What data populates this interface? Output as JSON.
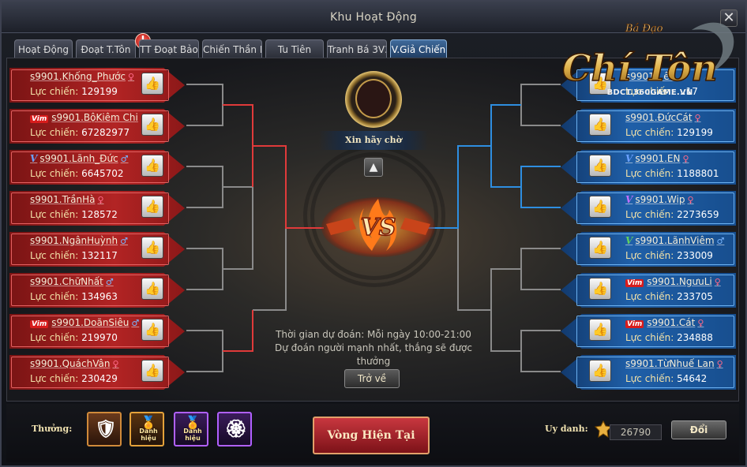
{
  "window": {
    "title": "Khu Hoạt Động",
    "close_label": "✕"
  },
  "tabs": [
    {
      "label": "Hoạt Động"
    },
    {
      "label": "Đoạt T.Tôn"
    },
    {
      "label": "TT Đoạt Bảo"
    },
    {
      "label": "Chiến Thần Lộ"
    },
    {
      "label": "Tu Tiên"
    },
    {
      "label": "Tranh Bá 3V3"
    },
    {
      "label": "V.Giả Chiến"
    }
  ],
  "active_tab": "V.Giả Chiến",
  "alert_badge": "!",
  "power_label": "Lực chiến:",
  "left_players": [
    {
      "name": "s9901.Khống_Phước",
      "power": "129199",
      "gender": "♀",
      "vip": ""
    },
    {
      "name": "s9901.BộKiêm Chi",
      "power": "67282977",
      "gender": "",
      "vip": "Vim"
    },
    {
      "name": "s9901.Lãnh_Đức",
      "power": "6645702",
      "gender": "♂",
      "vip": "V"
    },
    {
      "name": "s9901.TrầnHà",
      "power": "128572",
      "gender": "♀",
      "vip": ""
    },
    {
      "name": "s9901.NgânHuỳnh",
      "power": "132117",
      "gender": "♂",
      "vip": ""
    },
    {
      "name": "s9901.ChữNhất",
      "power": "134963",
      "gender": "♂",
      "vip": ""
    },
    {
      "name": "s9901.DoãnSiêu",
      "power": "219970",
      "gender": "♂",
      "vip": "Vim"
    },
    {
      "name": "s9901.QuáchVân",
      "power": "230429",
      "gender": "♀",
      "vip": ""
    }
  ],
  "right_players": [
    {
      "name": "s9901...ên",
      "power": "...17",
      "gender": "",
      "vip": ""
    },
    {
      "name": "s9901.ĐứcCát",
      "power": "129199",
      "gender": "♀",
      "vip": ""
    },
    {
      "name": "s9901.EN",
      "power": "1188801",
      "gender": "♀",
      "vip": "V"
    },
    {
      "name": "s9901.Wip",
      "power": "2273659",
      "gender": "♀",
      "vip": "V"
    },
    {
      "name": "s9901.LãnhViêm",
      "power": "233009",
      "gender": "♂",
      "vip": "V"
    },
    {
      "name": "s9901.NgưuLi",
      "power": "233705",
      "gender": "♀",
      "vip": "Vim"
    },
    {
      "name": "s9901.Cát",
      "power": "234888",
      "gender": "♀",
      "vip": "Vim"
    },
    {
      "name": "s9901.TừNhuế Lan",
      "power": "54642",
      "gender": "♀",
      "vip": ""
    }
  ],
  "center": {
    "banner": "Xin hãy chờ",
    "vs_text": "VS",
    "info_line1": "Thời gian dự đoán: Mỗi ngày 10:00-21:00",
    "info_line2": "Dự đoán người mạnh nhất, thắng sẽ được",
    "info_line3": "thưởng",
    "back_label": "Trở về"
  },
  "logo": {
    "top": "Bá Đạo",
    "main": "Chí Tôn",
    "url": "BDCT.360GAME.VN"
  },
  "bottom": {
    "reward_label": "Thưởng:",
    "rewards": [
      {
        "icon": "armor-icon",
        "tag": ""
      },
      {
        "icon": "title-icon",
        "tag": "Danh hiệu"
      },
      {
        "icon": "title-icon",
        "tag": "Danh hiệu"
      },
      {
        "icon": "badge-icon",
        "tag": ""
      }
    ],
    "current_round_label": "Vòng Hiện Tại",
    "rep_label": "Uy danh:",
    "rep_value": "26790",
    "exchange_label": "Đổi"
  },
  "colors": {
    "left_accent": "#b22424",
    "right_accent": "#1f5fa8",
    "left_line": "#e03a3a",
    "right_line": "#2e8ee0"
  }
}
